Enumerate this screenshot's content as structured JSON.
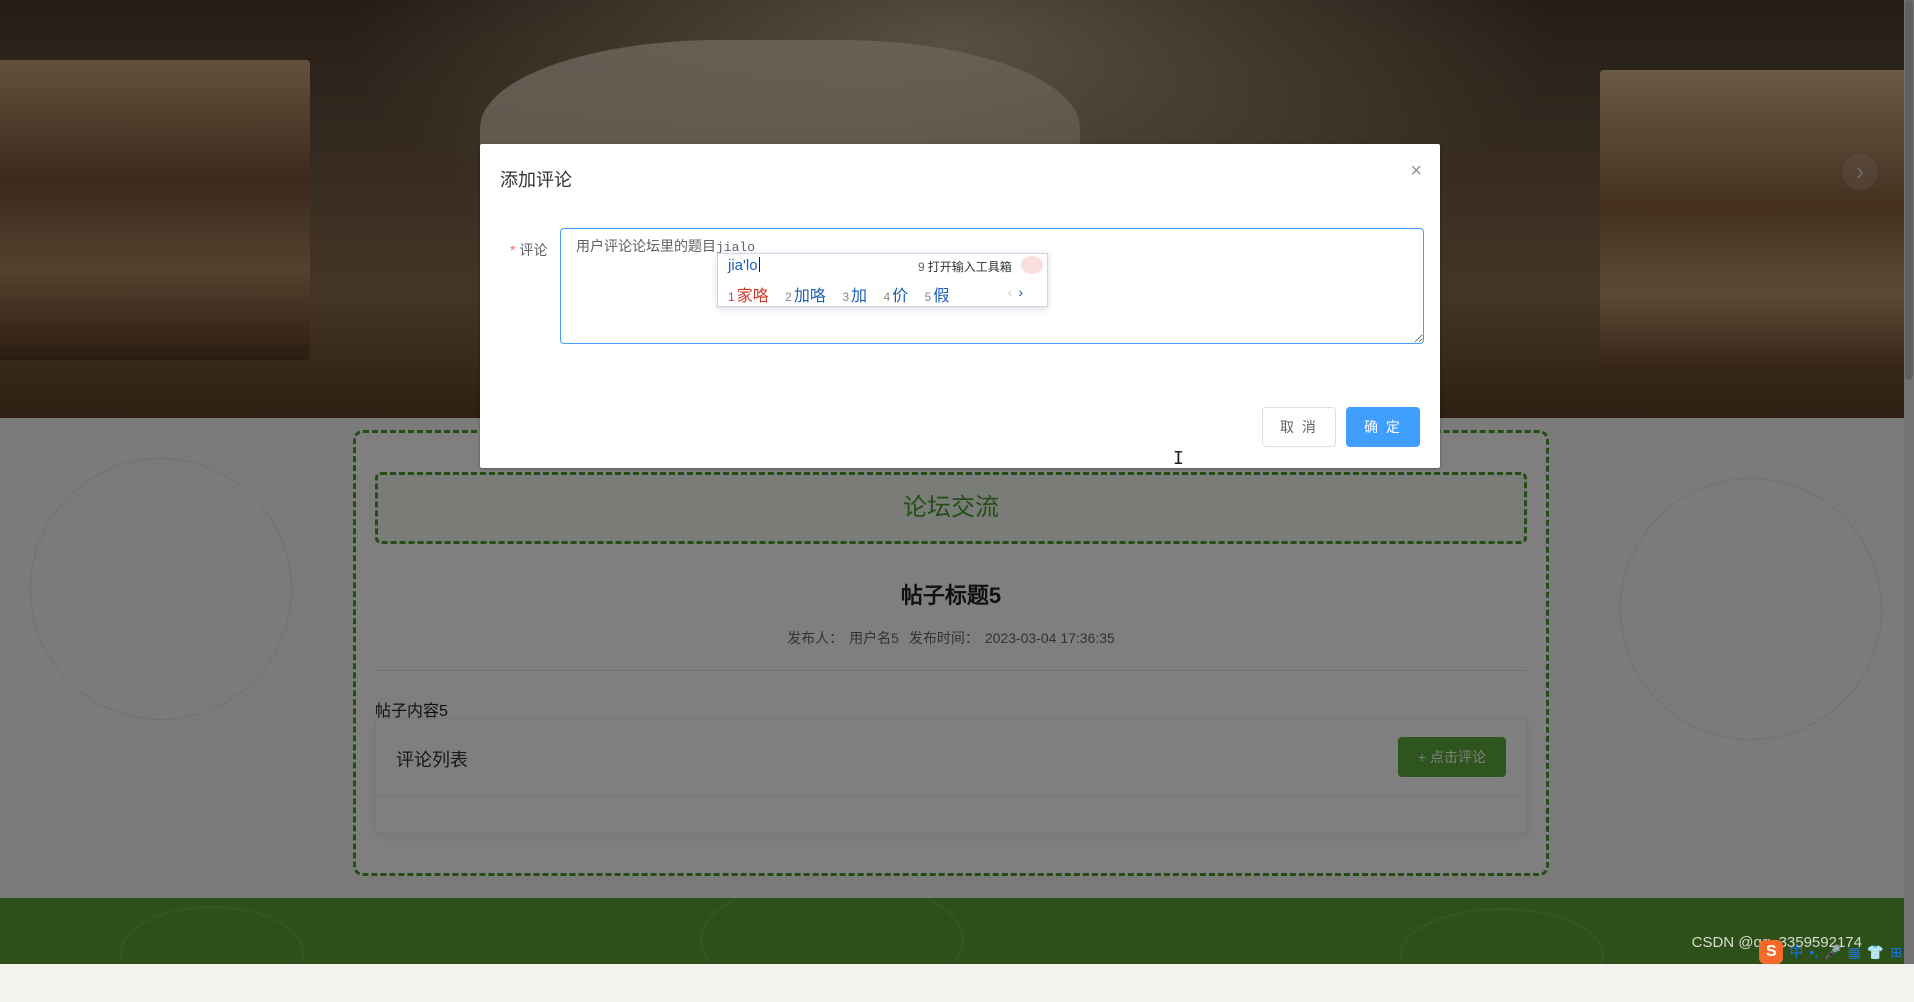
{
  "dialog": {
    "title": "添加评论",
    "close_glyph": "×",
    "field_label": "评论",
    "required_mark": "*",
    "textarea_text": "用户评论论坛里的题目",
    "textarea_pinyin": "jialo",
    "cancel_label": "取 消",
    "confirm_label": "确 定"
  },
  "ime": {
    "composition": "jia'lo",
    "toolbox_number": "9",
    "toolbox_label": "打开输入工具箱",
    "candidates": [
      {
        "n": "1",
        "text": "家咯"
      },
      {
        "n": "2",
        "text": "加咯"
      },
      {
        "n": "3",
        "text": "加"
      },
      {
        "n": "4",
        "text": "价"
      },
      {
        "n": "5",
        "text": "假"
      }
    ],
    "prev_glyph": "‹",
    "next_glyph": "›"
  },
  "page": {
    "section_title": "论坛交流",
    "post_title": "帖子标题5",
    "publisher_label": "发布人：",
    "publisher": "用户名5",
    "time_label": "发布时间：",
    "time": "2023-03-04 17:36:35",
    "post_content": "帖子内容5",
    "comment_list_label": "评论列表",
    "add_comment_label": "+ 点击评论"
  },
  "banner": {
    "next_glyph": "›"
  },
  "watermark": "CSDN @qq_3359592174",
  "tray": {
    "logo": "S",
    "items": [
      "中",
      "•,",
      "🎤",
      "▦",
      "👕",
      "⊞"
    ]
  },
  "colors": {
    "primary": "#409eff",
    "green": "#4a9a2e",
    "footer": "#5a9e30",
    "ime_first": "#d23a2a"
  }
}
